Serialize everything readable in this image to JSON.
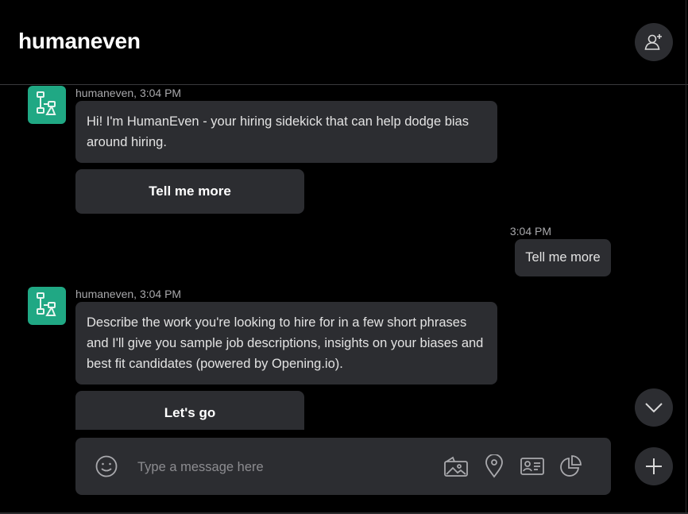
{
  "header": {
    "title": "humaneven",
    "add_user_icon": "add-user-icon"
  },
  "messages": [
    {
      "meta": "humaneven, 3:04 PM",
      "text": "Hi! I'm HumanEven - your hiring sidekick that can help dodge bias around hiring.",
      "quick_reply": "Tell me more"
    },
    {
      "outgoing_time": "3:04 PM",
      "outgoing_text": "Tell me more"
    },
    {
      "meta": "humaneven, 3:04 PM",
      "text": "Describe the work you're looking to hire for in a few short phrases and I'll give you sample job descriptions, insights on your biases and best fit candidates (powered by Opening.io).",
      "quick_reply": "Let's go"
    }
  ],
  "composer": {
    "placeholder": "Type a message here",
    "icons": [
      "emoji-icon",
      "image-icon",
      "location-icon",
      "contact-card-icon",
      "chart-icon"
    ]
  },
  "colors": {
    "background": "#000000",
    "bubble": "#2c2d31",
    "avatar": "#20a884"
  }
}
